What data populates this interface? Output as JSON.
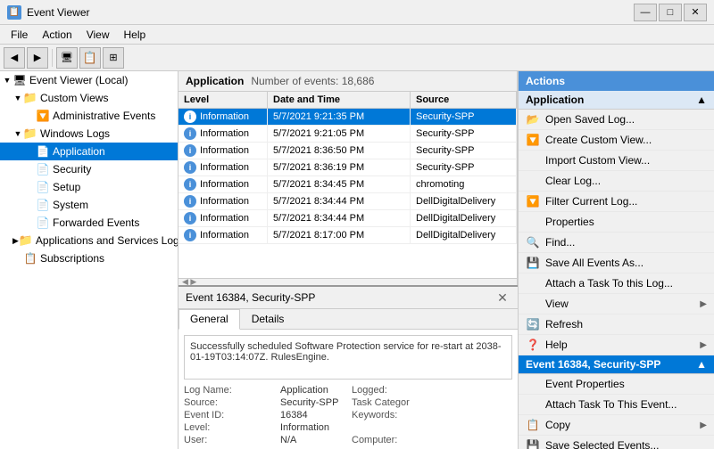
{
  "titleBar": {
    "title": "Event Viewer",
    "icon": "📋",
    "controls": [
      "—",
      "□",
      "✕"
    ]
  },
  "menuBar": {
    "items": [
      "File",
      "Action",
      "View",
      "Help"
    ]
  },
  "toolbar": {
    "buttons": [
      "◀",
      "▶",
      "🖥",
      "📋",
      "🔲"
    ]
  },
  "leftPane": {
    "tree": [
      {
        "id": "local",
        "label": "Event Viewer (Local)",
        "level": 0,
        "expanded": true,
        "icon": "computer"
      },
      {
        "id": "custom-views",
        "label": "Custom Views",
        "level": 1,
        "expanded": true,
        "icon": "folder"
      },
      {
        "id": "admin-events",
        "label": "Administrative Events",
        "level": 2,
        "expanded": false,
        "icon": "filter"
      },
      {
        "id": "windows-logs",
        "label": "Windows Logs",
        "level": 1,
        "expanded": true,
        "icon": "folder"
      },
      {
        "id": "application",
        "label": "Application",
        "level": 2,
        "expanded": false,
        "icon": "log",
        "selected": true
      },
      {
        "id": "security",
        "label": "Security",
        "level": 2,
        "expanded": false,
        "icon": "log"
      },
      {
        "id": "setup",
        "label": "Setup",
        "level": 2,
        "expanded": false,
        "icon": "log"
      },
      {
        "id": "system",
        "label": "System",
        "level": 2,
        "expanded": false,
        "icon": "log"
      },
      {
        "id": "forwarded",
        "label": "Forwarded Events",
        "level": 2,
        "expanded": false,
        "icon": "log"
      },
      {
        "id": "app-services",
        "label": "Applications and Services Logs",
        "level": 1,
        "expanded": false,
        "icon": "folder"
      },
      {
        "id": "subscriptions",
        "label": "Subscriptions",
        "level": 1,
        "expanded": false,
        "icon": "sub"
      }
    ]
  },
  "eventsTable": {
    "title": "Application",
    "eventCount": "Number of events: 18,686",
    "columns": [
      "Level",
      "Date and Time",
      "Source"
    ],
    "rows": [
      {
        "level": "Information",
        "datetime": "5/7/2021 9:21:35 PM",
        "source": "Security-SPP",
        "selected": true
      },
      {
        "level": "Information",
        "datetime": "5/7/2021 9:21:05 PM",
        "source": "Security-SPP",
        "selected": false
      },
      {
        "level": "Information",
        "datetime": "5/7/2021 8:36:50 PM",
        "source": "Security-SPP",
        "selected": false
      },
      {
        "level": "Information",
        "datetime": "5/7/2021 8:36:19 PM",
        "source": "Security-SPP",
        "selected": false
      },
      {
        "level": "Information",
        "datetime": "5/7/2021 8:34:45 PM",
        "source": "chromoting",
        "selected": false
      },
      {
        "level": "Information",
        "datetime": "5/7/2021 8:34:44 PM",
        "source": "DellDigitalDelivery",
        "selected": false
      },
      {
        "level": "Information",
        "datetime": "5/7/2021 8:34:44 PM",
        "source": "DellDigitalDelivery",
        "selected": false
      },
      {
        "level": "Information",
        "datetime": "5/7/2021 8:17:00 PM",
        "source": "DellDigitalDelivery",
        "selected": false
      }
    ]
  },
  "detailPane": {
    "title": "Event 16384, Security-SPP",
    "tabs": [
      "General",
      "Details"
    ],
    "activeTab": "General",
    "description": "Successfully scheduled Software Protection service for re-start at 2038-01-19T03:14:07Z. RulesEngine.",
    "fields": {
      "logName": {
        "label": "Log Name:",
        "value": "Application"
      },
      "source": {
        "label": "Source:",
        "value": "Security-SPP"
      },
      "eventId": {
        "label": "Event ID:",
        "value": "16384"
      },
      "level": {
        "label": "Level:",
        "value": "Information"
      },
      "user": {
        "label": "User:",
        "value": "N/A"
      },
      "logged": {
        "label": "Logged:",
        "value": ""
      },
      "taskCategory": {
        "label": "Task Categor",
        "value": ""
      },
      "keywords": {
        "label": "Keywords:",
        "value": ""
      },
      "computer": {
        "label": "Computer:",
        "value": ""
      }
    }
  },
  "actionsPane": {
    "title": "Actions",
    "sections": [
      {
        "id": "application-section",
        "header": "Application",
        "highlighted": false,
        "items": [
          {
            "id": "open-saved",
            "label": "Open Saved Log...",
            "icon": "📂"
          },
          {
            "id": "create-custom",
            "label": "Create Custom View...",
            "icon": "🔽"
          },
          {
            "id": "import-custom",
            "label": "Import Custom View...",
            "icon": ""
          },
          {
            "id": "clear-log",
            "label": "Clear Log...",
            "icon": ""
          },
          {
            "id": "filter-current",
            "label": "Filter Current Log...",
            "icon": "🔽"
          },
          {
            "id": "properties",
            "label": "Properties",
            "icon": ""
          },
          {
            "id": "find",
            "label": "Find...",
            "icon": "🔍"
          },
          {
            "id": "save-all",
            "label": "Save All Events As...",
            "icon": "💾"
          },
          {
            "id": "attach-task",
            "label": "Attach a Task To this Log...",
            "icon": ""
          },
          {
            "id": "view",
            "label": "View",
            "icon": "",
            "hasSubmenu": true
          },
          {
            "id": "refresh",
            "label": "Refresh",
            "icon": "🔄"
          },
          {
            "id": "help",
            "label": "Help",
            "icon": "❓",
            "hasSubmenu": true
          }
        ]
      },
      {
        "id": "event-section",
        "header": "Event 16384, Security-SPP",
        "highlighted": true,
        "items": [
          {
            "id": "event-properties",
            "label": "Event Properties",
            "icon": ""
          },
          {
            "id": "attach-task-event",
            "label": "Attach Task To This Event...",
            "icon": ""
          },
          {
            "id": "copy",
            "label": "Copy",
            "icon": "📋",
            "hasSubmenu": true
          },
          {
            "id": "save-selected",
            "label": "Save Selected Events...",
            "icon": "💾"
          }
        ]
      }
    ]
  }
}
